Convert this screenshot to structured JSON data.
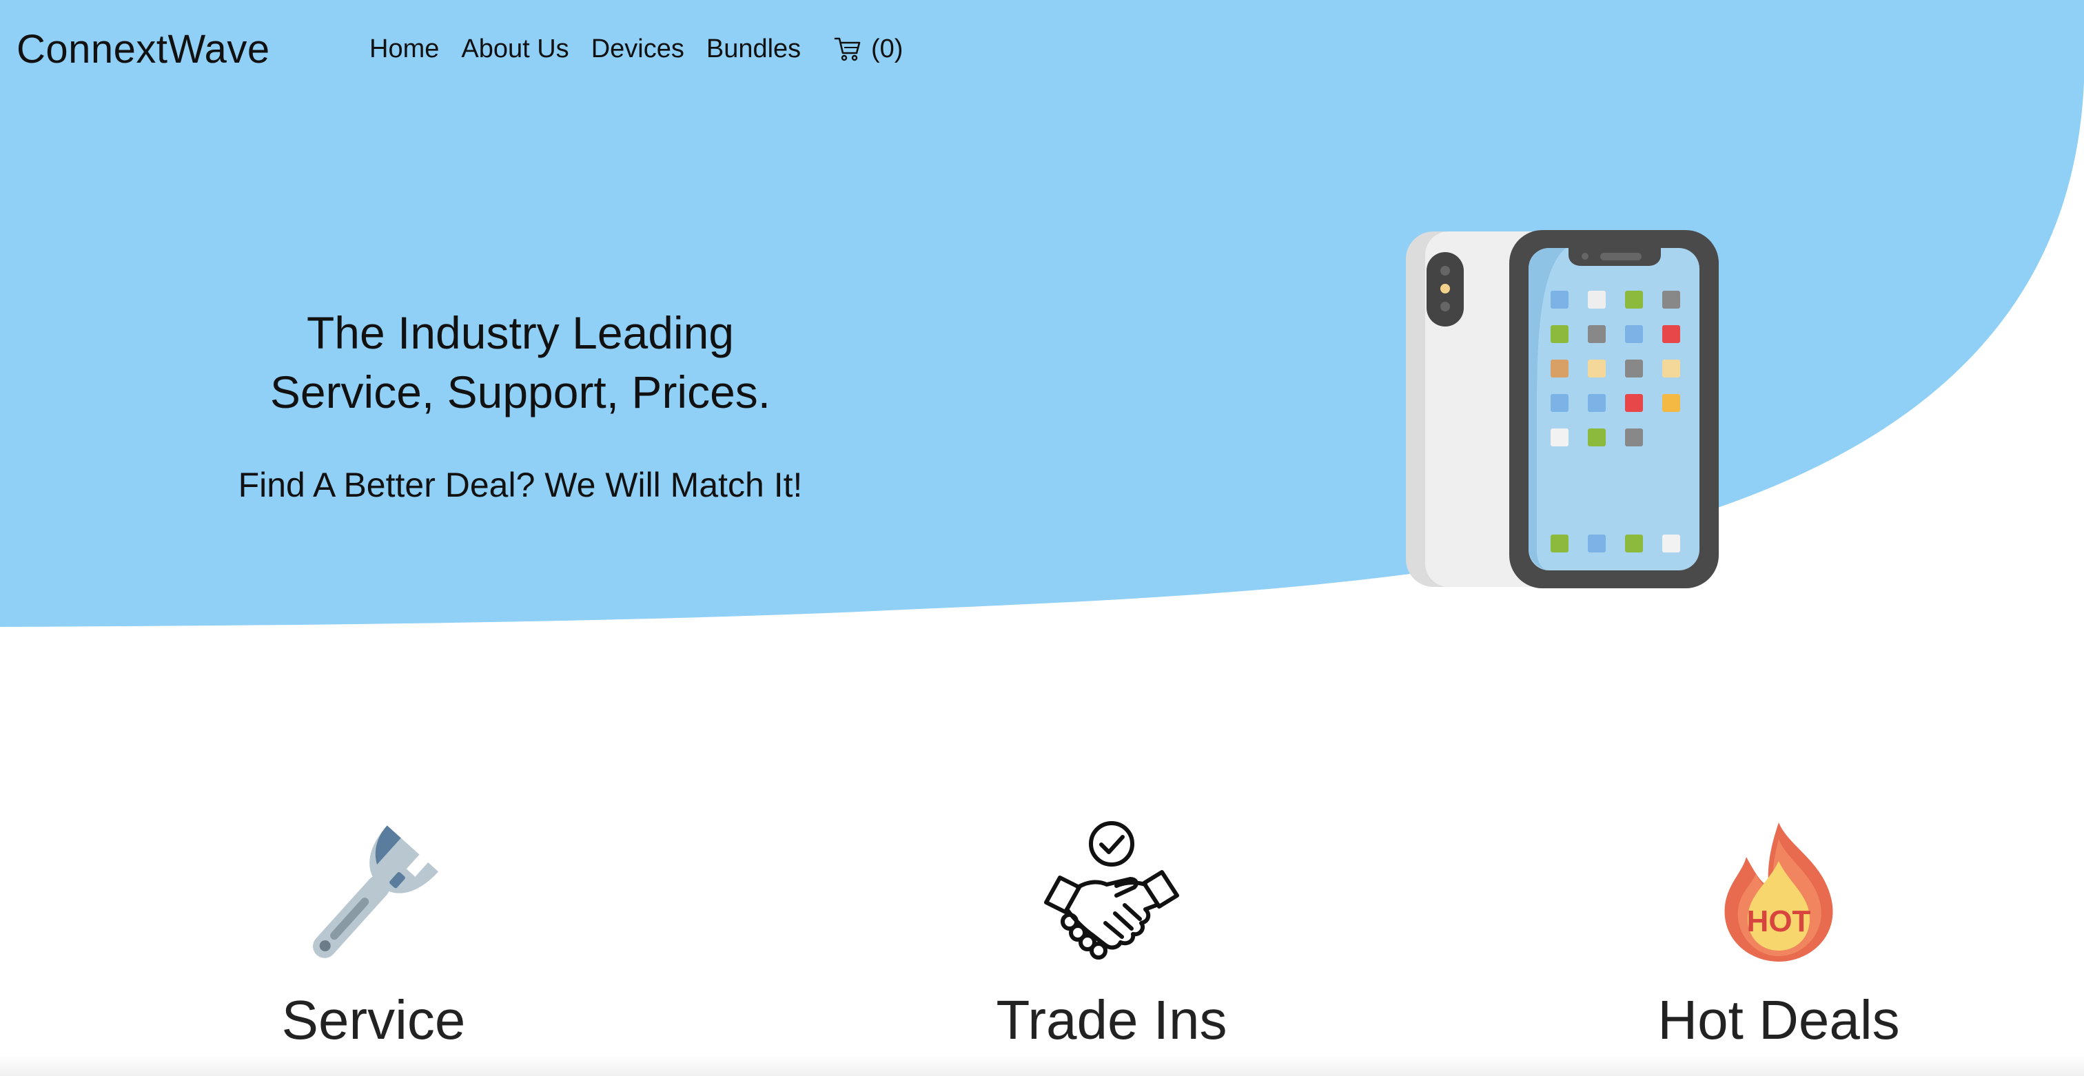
{
  "brand": {
    "name": "ConnextWave"
  },
  "nav": {
    "items": [
      {
        "label": "Home"
      },
      {
        "label": "About Us"
      },
      {
        "label": "Devices"
      },
      {
        "label": "Bundles"
      }
    ],
    "cart": {
      "icon": "shopping-cart-icon",
      "count_label": "(0)"
    }
  },
  "hero": {
    "title_line1": "The Industry Leading",
    "title_line2": "Service, Support, Prices.",
    "subtitle": "Find A Better Deal? We Will Match It!",
    "background_color": "#91d0f6",
    "image": "smartphone-illustration"
  },
  "features": [
    {
      "title": "Service",
      "icon": "wrench-icon"
    },
    {
      "title": "Trade Ins",
      "icon": "handshake-icon"
    },
    {
      "title": "Hot Deals",
      "icon": "hot-flame-icon",
      "badge": "HOT"
    }
  ]
}
